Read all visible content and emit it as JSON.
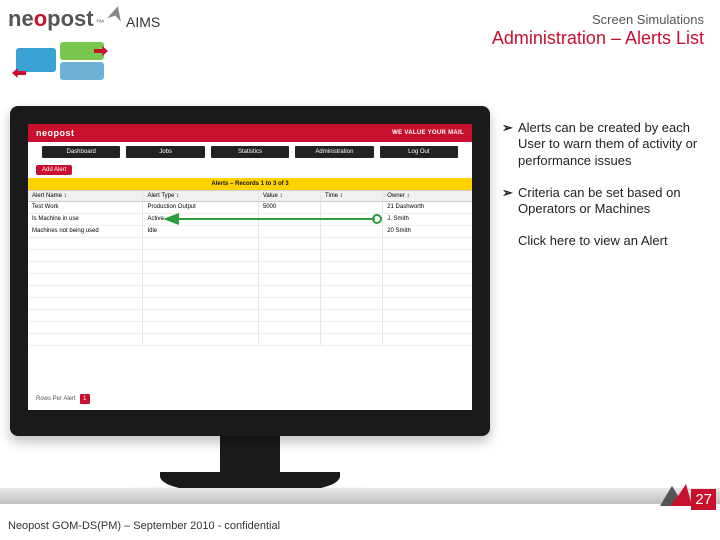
{
  "header": {
    "brand_left": "ne",
    "brand_o": "o",
    "brand_right": "post",
    "trademark": "™",
    "aims": "AIMS",
    "subtitle": "Screen Simulations",
    "title": "Administration – Alerts List"
  },
  "bullets": [
    {
      "marker": "➢",
      "text": "Alerts can be created by each User to warn them of activity or performance issues"
    },
    {
      "marker": "➢",
      "text": "Criteria can be set based on Operators or Machines"
    },
    {
      "marker": "",
      "text": "Click here to view an Alert"
    }
  ],
  "screen": {
    "brandbar_left": "neopost",
    "brandbar_right": "WE VALUE YOUR MAIL",
    "tabs": [
      "Dashboard",
      "Jobs",
      "Statistics",
      "Administration",
      "Log Out"
    ],
    "add_button": "Add Alert",
    "listbar": "Alerts – Records 1 to 3 of 3",
    "columns": [
      "Alert Name ↕",
      "Alert Type ↕",
      "Value ↕",
      "Time ↕",
      "Owner ↕"
    ],
    "rows": [
      {
        "c1": "Test Work",
        "c2": "Production Output",
        "c3": "5000",
        "c4": "",
        "c5": "21 Dashworth"
      },
      {
        "c1": "Is Machine in use",
        "c2": "Active",
        "c3": "",
        "c4": "",
        "c5": "J. Smith"
      },
      {
        "c1": "Machines not being used",
        "c2": "Idle",
        "c3": "",
        "c4": "",
        "c5": "20 Smith"
      }
    ],
    "pager_label": "Rows Per Alert",
    "pager_page": "1"
  },
  "footer": {
    "slidenum": "27",
    "confidential": "Neopost GOM-DS(PM) – September 2010 - confidential"
  }
}
